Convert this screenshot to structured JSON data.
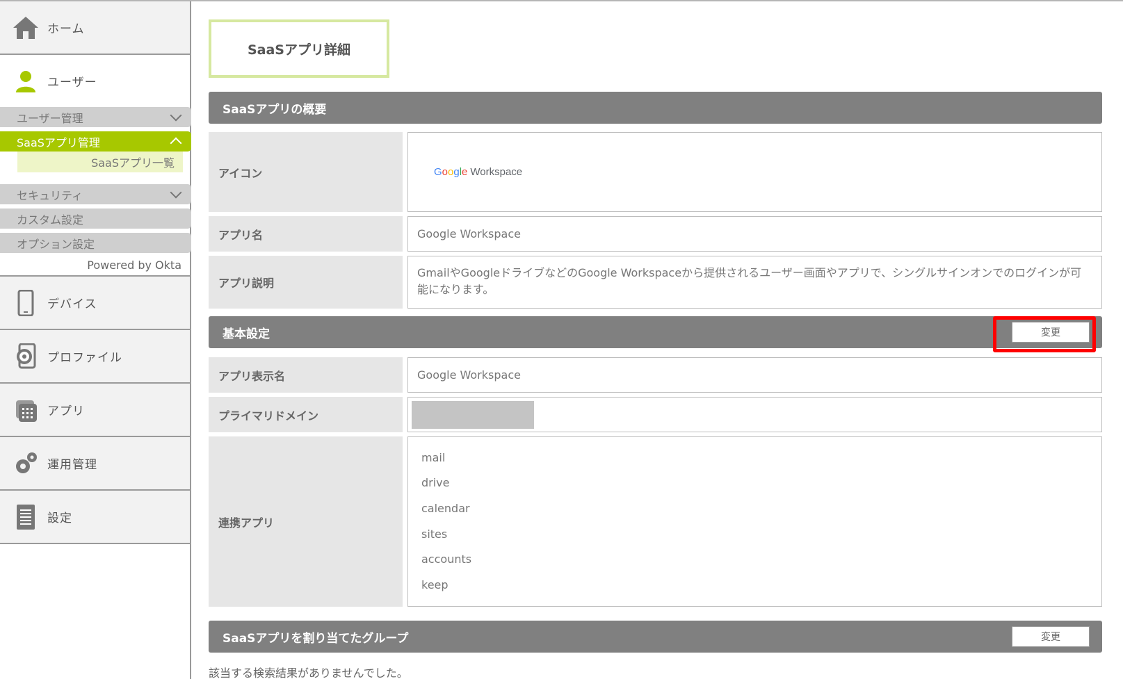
{
  "sidebar": {
    "home": "ホーム",
    "user": "ユーザー",
    "sub_items": {
      "user_mgmt": "ユーザー管理",
      "saas_mgmt": "SaaSアプリ管理",
      "saas_list": "SaaSアプリ一覧",
      "security": "セキュリティ",
      "custom": "カスタム設定",
      "option": "オプション設定"
    },
    "powered": "Powered by Okta",
    "device": "デバイス",
    "profile": "プロファイル",
    "app": "アプリ",
    "ops": "運用管理",
    "settings": "設定"
  },
  "page_title": "SaaSアプリ詳細",
  "overview": {
    "header": "SaaSアプリの概要",
    "icon_label": "アイコン",
    "logo": {
      "g1": "G",
      "g2": "o",
      "g3": "o",
      "g4": "g",
      "g5": "l",
      "g6": "e",
      "ws": "Workspace"
    },
    "app_name_label": "アプリ名",
    "app_name": "Google Workspace",
    "desc_label": "アプリ説明",
    "desc": "GmailやGoogleドライブなどのGoogle Workspaceから提供されるユーザー画面やアプリで、シングルサインオンでのログインが可能になります。"
  },
  "basic": {
    "header": "基本設定",
    "change": "変更",
    "display_name_label": "アプリ表示名",
    "display_name": "Google Workspace",
    "domain_label": "プライマリドメイン",
    "linked_label": "連携アプリ",
    "linked_apps": [
      "mail",
      "drive",
      "calendar",
      "sites",
      "accounts",
      "keep"
    ]
  },
  "groups": {
    "header": "SaaSアプリを割り当てたグループ",
    "change": "変更",
    "no_result": "該当する検索結果がありませんでした。"
  },
  "colors": {
    "accent": "#a7c800",
    "bar": "#808080",
    "highlight": "#ff0000"
  }
}
